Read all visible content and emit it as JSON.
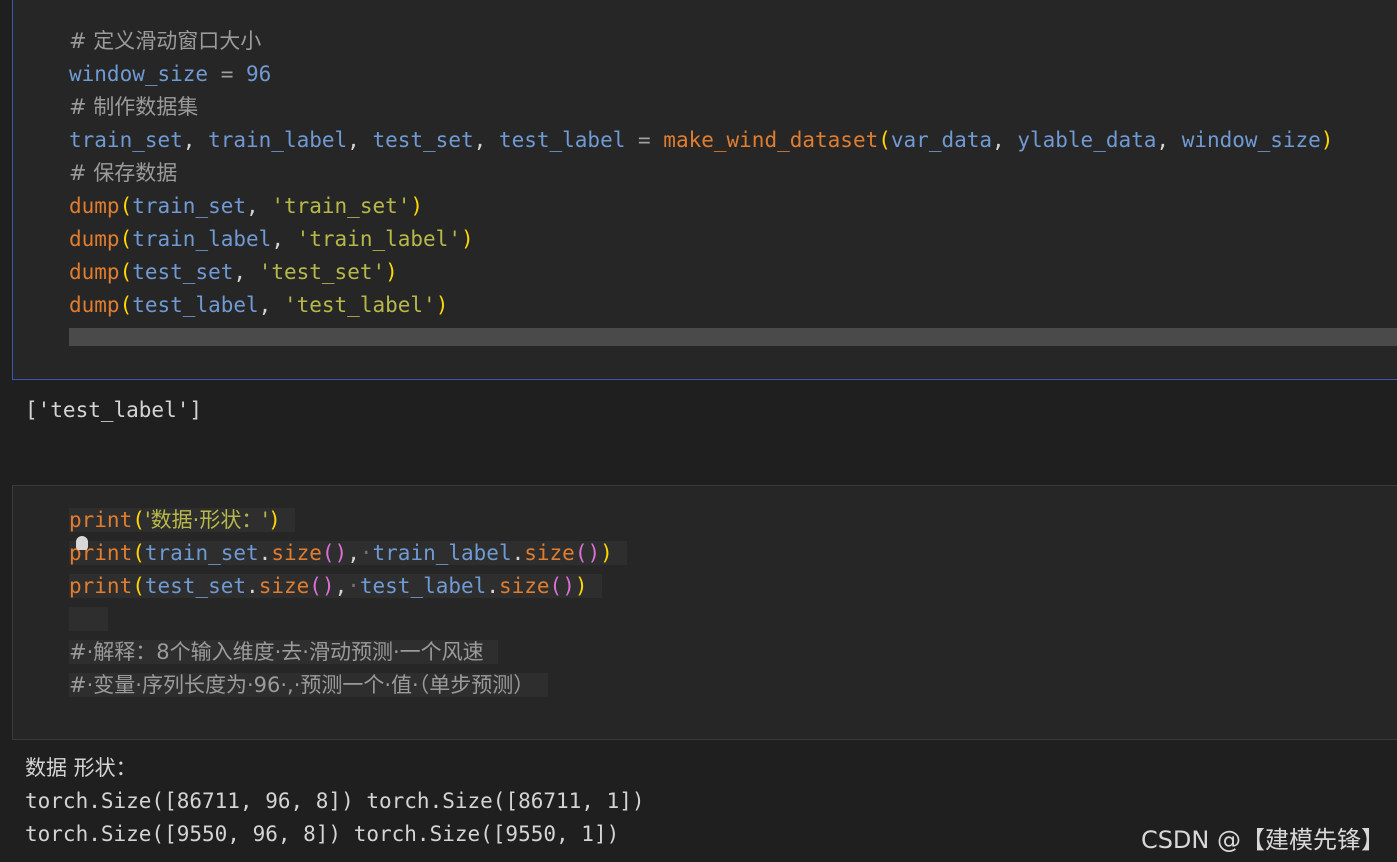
{
  "cell1": {
    "comment1": "# 定义滑动窗口大小",
    "window_size_var": "window_size",
    "window_size_val": "96",
    "comment2": "# 制作数据集",
    "var_train_set": "train_set",
    "var_train_label": "train_label",
    "var_test_set": "test_set",
    "var_test_label": "test_label",
    "fn_make": "make_wind_dataset",
    "arg_var_data": "var_data",
    "arg_ylable_data": "ylable_data",
    "arg_window_size": "window_size",
    "comment3": "# 保存数据",
    "fn_dump": "dump",
    "str_train_set": "'train_set'",
    "str_train_label": "'train_label'",
    "str_test_set": "'test_set'",
    "str_test_label": "'test_label'"
  },
  "output1": "['test_label']",
  "cell2": {
    "fn_print": "print",
    "str_shape": "'数据·形状：'",
    "var_train_set": "train_set",
    "var_train_label": "train_label",
    "var_test_set": "test_set",
    "var_test_label": "test_label",
    "method_size": "size",
    "comment1": "#·解释：8个输入维度·去·滑动预测·一个风速",
    "comment2": "#·变量·序列长度为·96·,·预测一个·值·（单步预测）"
  },
  "output2": {
    "line1": "数据 形状：",
    "line2": "torch.Size([86711, 96, 8]) torch.Size([86711, 1])",
    "line3": "torch.Size([9550, 96, 8]) torch.Size([9550, 1])"
  },
  "watermark": "CSDN @【建模先锋】",
  "colors": {
    "background": "#1f1f1f",
    "cell_background": "#262626",
    "active_cell_border": "#3e57a8",
    "function": "#e07d2f",
    "variable": "#6f9ad3",
    "string": "#b8b84a",
    "comment": "#9b9b9b",
    "bracket_yellow": "#ffd700",
    "bracket_purple": "#da70d6"
  }
}
